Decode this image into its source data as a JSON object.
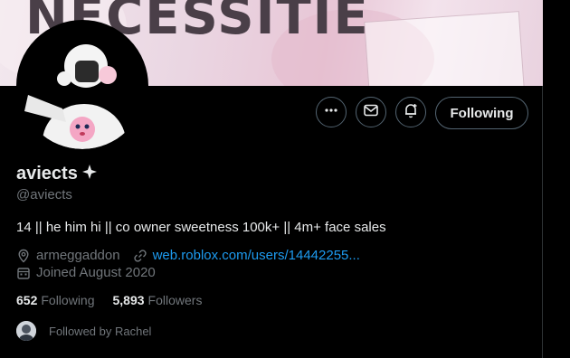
{
  "banner": {
    "text": "NECESSITIE"
  },
  "actions": {
    "more_icon": "more-icon",
    "message_icon": "mail-icon",
    "notify_icon": "bell-plus-icon",
    "following_label": "Following"
  },
  "profile": {
    "display_name": "aviects",
    "badge_icon": "sparkle-icon",
    "handle": "@aviects",
    "bio": "14 || he him hi || co owner sweetness 100k+ || 4m+ face sales",
    "location": "armeggaddon",
    "website": "web.roblox.com/users/14442255...",
    "joined": "Joined August 2020"
  },
  "stats": {
    "following_count": "652",
    "following_label": "Following",
    "followers_count": "5,893",
    "followers_label": "Followers"
  },
  "followed_by": {
    "text": "Followed by Rachel"
  },
  "colors": {
    "accent": "#1d9bf0",
    "muted": "#71767b",
    "text": "#e7e9ea",
    "border": "#536471"
  }
}
